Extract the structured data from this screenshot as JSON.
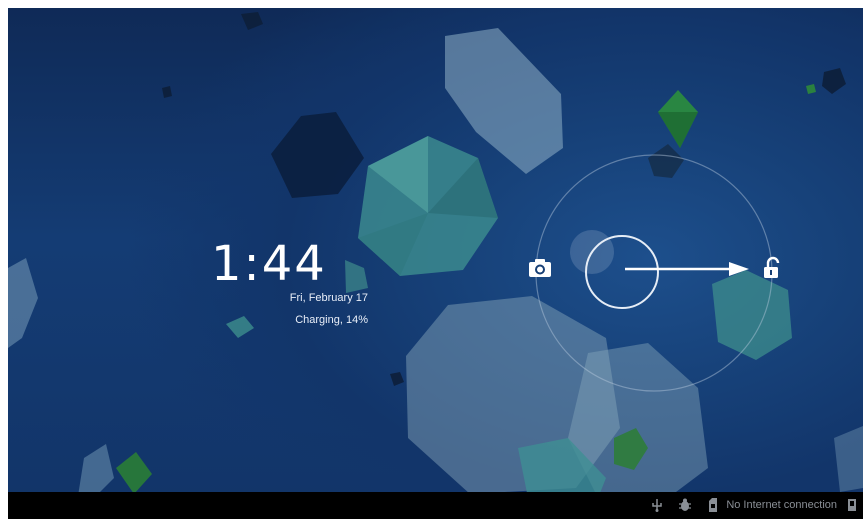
{
  "lockscreen": {
    "time": "1:44",
    "date": "Fri, February 17",
    "charging": "Charging, 14%"
  },
  "unlock_widget": {
    "left_target_icon": "camera-icon",
    "right_target_icon": "unlock-icon",
    "handle_icon": "ring-handle",
    "gesture_icon": "arrow-right-icon"
  },
  "status_bar": {
    "icons": [
      "usb-icon",
      "debug-icon",
      "sd-card-icon",
      "notification-icon"
    ],
    "connection_text": "No Internet connection"
  },
  "colors": {
    "background": "#143c74",
    "text": "#ffffff",
    "status_bar": "#000000",
    "status_text": "#8a8f96"
  }
}
